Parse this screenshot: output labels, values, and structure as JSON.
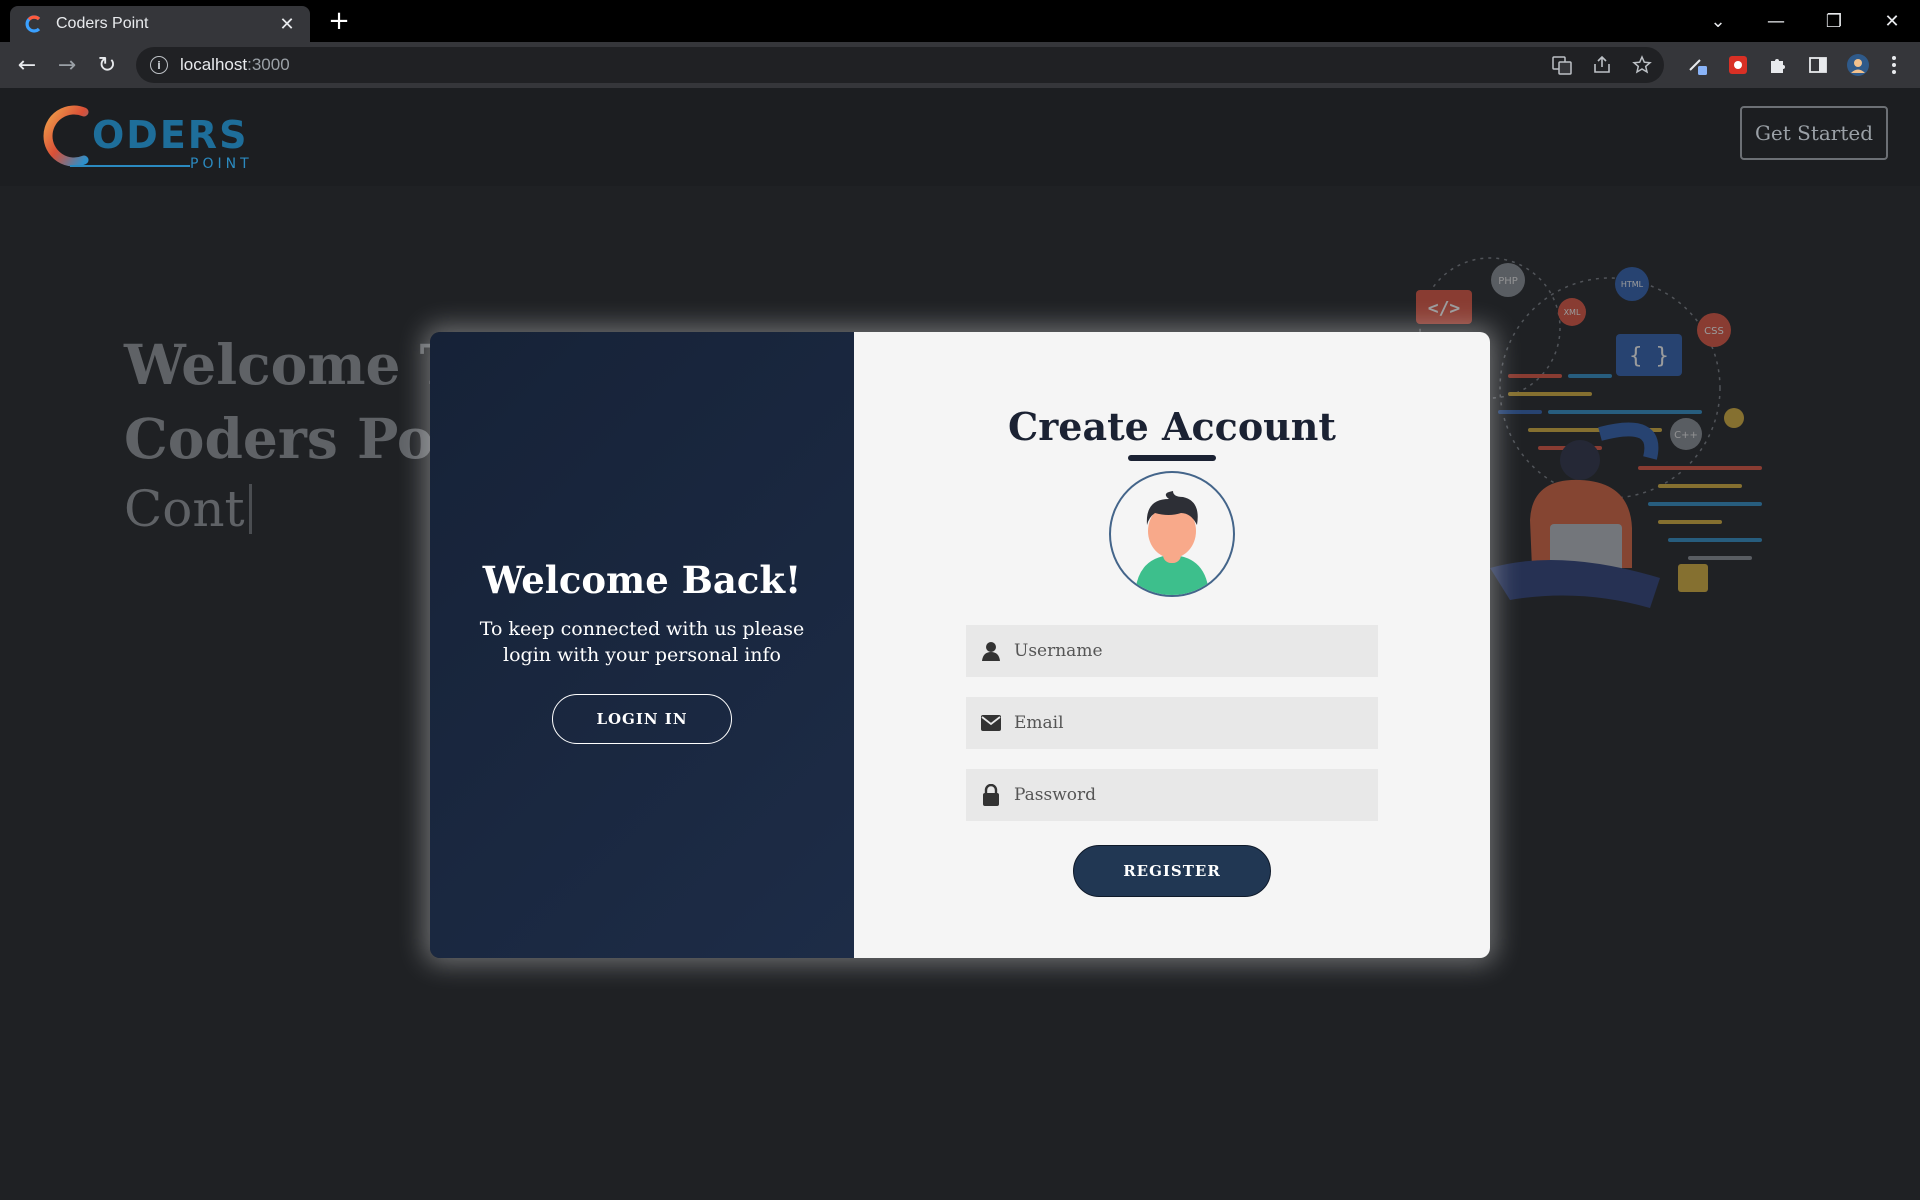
{
  "browser": {
    "tab_title": "Coders Point",
    "tab_close": "✕",
    "new_tab": "+",
    "url_host": "localhost",
    "url_port": ":3000",
    "controls": {
      "dropdown": "⌄",
      "minimize": "—",
      "restore": "❐",
      "close": "✕"
    },
    "nav": {
      "back": "←",
      "forward": "→",
      "reload": "↻"
    },
    "toolbar_icons": [
      "translate-icon",
      "share-icon",
      "bookmark-star-icon",
      "pen-extension-icon",
      "red-extension-icon",
      "extensions-puzzle-icon",
      "side-panel-icon",
      "profile-avatar-icon",
      "menu-kebab-icon"
    ]
  },
  "site": {
    "logo_main": "ODERS",
    "logo_sub": "POINT",
    "get_started": "Get Started",
    "hero_line1": "Welcome To",
    "hero_line2": "Coders Point",
    "hero_typed": "Cont",
    "illustration_tags": [
      "PHP",
      "HTML",
      "XML",
      "CSS",
      "C++",
      "{ }",
      "</>"
    ]
  },
  "modal": {
    "overlay_title": "Welcome Back!",
    "overlay_text": "To keep connected with us please login with your personal info",
    "login_button": "LOGIN IN",
    "form_title": "Create Account",
    "username_placeholder": "Username",
    "email_placeholder": "Email",
    "password_placeholder": "Password",
    "register_button": "REGISTER"
  },
  "colors": {
    "page_background": "#1f2124",
    "modal_dark": "#162237",
    "button_navy": "#213753",
    "form_background": "#f5f5f5"
  }
}
